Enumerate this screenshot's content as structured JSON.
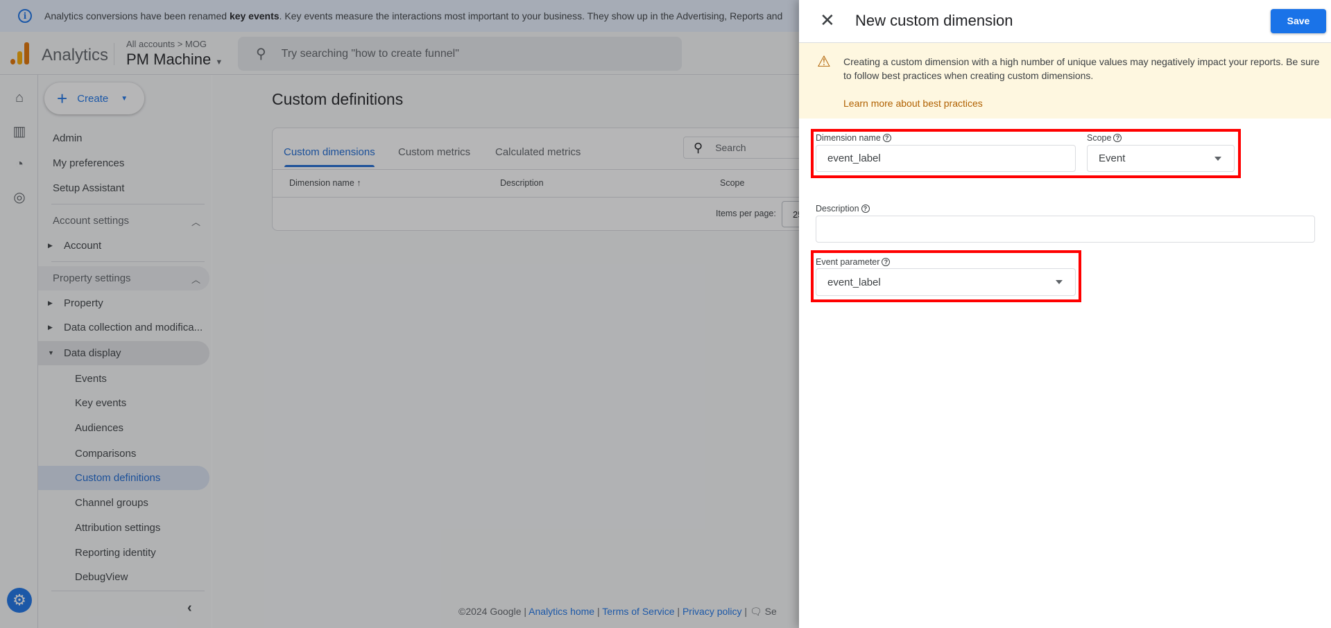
{
  "banner": {
    "pre": "Analytics conversions have been renamed ",
    "bold": "key events",
    "post": ". Key events measure the interactions most important to your business. They show up in the Advertising, Reports and"
  },
  "header": {
    "app_name": "Analytics",
    "breadcrumb": "All accounts > MOG",
    "property": "PM Machine",
    "search_placeholder": "Try searching \"how to create funnel\""
  },
  "nav": {
    "create": "Create",
    "top_items": [
      "Admin",
      "My preferences",
      "Setup Assistant"
    ],
    "account_settings": "Account settings",
    "account": "Account",
    "property_settings": "Property settings",
    "property": "Property",
    "data_collection": "Data collection and modifica...",
    "data_display": "Data display",
    "sub_items": [
      "Events",
      "Key events",
      "Audiences",
      "Comparisons",
      "Custom definitions",
      "Channel groups",
      "Attribution settings",
      "Reporting identity",
      "DebugView"
    ],
    "active": "Custom definitions"
  },
  "main": {
    "title": "Custom definitions",
    "tabs": [
      "Custom dimensions",
      "Custom metrics",
      "Calculated metrics"
    ],
    "active_tab": "Custom dimensions",
    "search_placeholder": "Search",
    "columns": [
      "Dimension name",
      "Description",
      "Scope"
    ],
    "items_per_page_label": "Items per page:",
    "items_per_page": "25"
  },
  "footer": {
    "copyright": "©2024 Google",
    "links": [
      "Analytics home",
      "Terms of Service",
      "Privacy policy"
    ],
    "feedback": "Se"
  },
  "panel": {
    "title": "New custom dimension",
    "save": "Save",
    "warning": "Creating a custom dimension with a high number of unique values may negatively impact your reports. Be sure to follow best practices when creating custom dimensions.",
    "warning_link": "Learn more about best practices",
    "dimension_name_label": "Dimension name",
    "dimension_name_value": "event_label",
    "scope_label": "Scope",
    "scope_value": "Event",
    "description_label": "Description",
    "description_value": "",
    "event_parameter_label": "Event parameter",
    "event_parameter_value": "event_label"
  },
  "colors": {
    "accent": "#1a73e8",
    "warning_bg": "#fef7e0",
    "warning_link": "#b06000",
    "highlight_box": "#ff0000"
  }
}
